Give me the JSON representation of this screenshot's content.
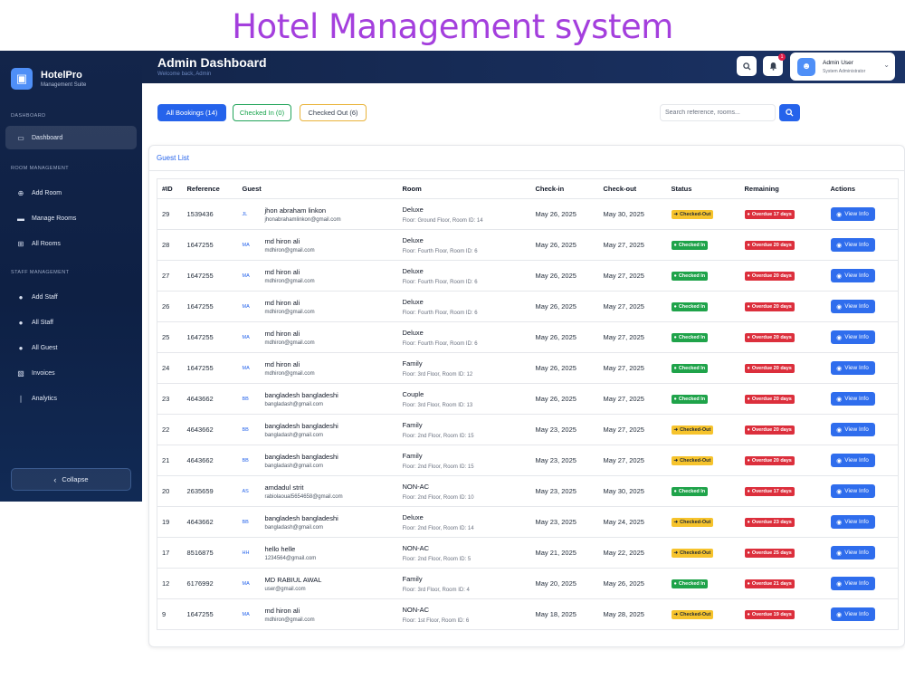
{
  "banner": {
    "title": "Hotel Management system"
  },
  "brand": {
    "name": "HotelPro",
    "subtitle": "Management Suite"
  },
  "sidebar": {
    "sections": [
      {
        "label": "DASHBOARD",
        "items": [
          {
            "label": "Dashboard",
            "icon": "monitor-icon",
            "active": true
          }
        ]
      },
      {
        "label": "ROOM MANAGEMENT",
        "items": [
          {
            "label": "Add Room",
            "icon": "plus-circle-icon"
          },
          {
            "label": "Manage Rooms",
            "icon": "bed-icon"
          },
          {
            "label": "All Rooms",
            "icon": "grid-icon"
          }
        ]
      },
      {
        "label": "STAFF MANAGEMENT",
        "items": [
          {
            "label": "Add Staff",
            "icon": "users-icon"
          },
          {
            "label": "All Staff",
            "icon": "users-icon"
          },
          {
            "label": "All Guest",
            "icon": "users-icon"
          },
          {
            "label": "Invoices",
            "icon": "file-icon"
          },
          {
            "label": "Analytics",
            "icon": "chart-icon"
          }
        ]
      }
    ],
    "collapse_label": "Collapse"
  },
  "header": {
    "title": "Admin Dashboard",
    "subtitle": "Welcome back, Admin",
    "notification_count": "1",
    "user": {
      "name": "Admin User",
      "role": "System Administrator"
    }
  },
  "filters": {
    "all": "All Bookings (14)",
    "checked_in": "Checked In (0)",
    "checked_out": "Checked Out (6)"
  },
  "search": {
    "placeholder": "Search reference, rooms..."
  },
  "tab": {
    "label": "Guest List"
  },
  "table": {
    "headers": [
      "#ID",
      "Reference",
      "Guest",
      "Room",
      "Check-in",
      "Check-out",
      "Status",
      "Remaining",
      "Actions"
    ],
    "view_label": "View Info",
    "rows": [
      {
        "id": "29",
        "ref": "1539436",
        "initials": "JL",
        "name": "jhon abraham linkon",
        "email": "jhonabrahamlinkon@gmail.com",
        "room": "Deluxe",
        "floor": "Floor: Ground Floor, Room ID: 14",
        "checkin": "May 26, 2025",
        "checkout": "May 30, 2025",
        "status": "Checked-Out",
        "status_type": "out",
        "remaining": "Overdue 17 days"
      },
      {
        "id": "28",
        "ref": "1647255",
        "initials": "MA",
        "name": "md hiron ali",
        "email": "mdhiron@gmail.com",
        "room": "Deluxe",
        "floor": "Floor: Fourth Floor, Room ID: 6",
        "checkin": "May 26, 2025",
        "checkout": "May 27, 2025",
        "status": "Checked In",
        "status_type": "in",
        "remaining": "Overdue 20 days"
      },
      {
        "id": "27",
        "ref": "1647255",
        "initials": "MA",
        "name": "md hiron ali",
        "email": "mdhiron@gmail.com",
        "room": "Deluxe",
        "floor": "Floor: Fourth Floor, Room ID: 6",
        "checkin": "May 26, 2025",
        "checkout": "May 27, 2025",
        "status": "Checked In",
        "status_type": "in",
        "remaining": "Overdue 20 days"
      },
      {
        "id": "26",
        "ref": "1647255",
        "initials": "MA",
        "name": "md hiron ali",
        "email": "mdhiron@gmail.com",
        "room": "Deluxe",
        "floor": "Floor: Fourth Floor, Room ID: 6",
        "checkin": "May 26, 2025",
        "checkout": "May 27, 2025",
        "status": "Checked In",
        "status_type": "in",
        "remaining": "Overdue 20 days"
      },
      {
        "id": "25",
        "ref": "1647255",
        "initials": "MA",
        "name": "md hiron ali",
        "email": "mdhiron@gmail.com",
        "room": "Deluxe",
        "floor": "Floor: Fourth Floor, Room ID: 6",
        "checkin": "May 26, 2025",
        "checkout": "May 27, 2025",
        "status": "Checked In",
        "status_type": "in",
        "remaining": "Overdue 20 days"
      },
      {
        "id": "24",
        "ref": "1647255",
        "initials": "MA",
        "name": "md hiron ali",
        "email": "mdhiron@gmail.com",
        "room": "Family",
        "floor": "Floor: 3rd Floor, Room ID: 12",
        "checkin": "May 26, 2025",
        "checkout": "May 27, 2025",
        "status": "Checked In",
        "status_type": "in",
        "remaining": "Overdue 20 days"
      },
      {
        "id": "23",
        "ref": "4643662",
        "initials": "BB",
        "name": "bangladesh bangladeshi",
        "email": "bangladash@gmail.com",
        "room": "Couple",
        "floor": "Floor: 3rd Floor, Room ID: 13",
        "checkin": "May 26, 2025",
        "checkout": "May 27, 2025",
        "status": "Checked In",
        "status_type": "in",
        "remaining": "Overdue 20 days"
      },
      {
        "id": "22",
        "ref": "4643662",
        "initials": "BB",
        "name": "bangladesh bangladeshi",
        "email": "bangladash@gmail.com",
        "room": "Family",
        "floor": "Floor: 2nd Floor, Room ID: 15",
        "checkin": "May 23, 2025",
        "checkout": "May 27, 2025",
        "status": "Checked-Out",
        "status_type": "out",
        "remaining": "Overdue 20 days"
      },
      {
        "id": "21",
        "ref": "4643662",
        "initials": "BB",
        "name": "bangladesh bangladeshi",
        "email": "bangladash@gmail.com",
        "room": "Family",
        "floor": "Floor: 2nd Floor, Room ID: 15",
        "checkin": "May 23, 2025",
        "checkout": "May 27, 2025",
        "status": "Checked-Out",
        "status_type": "out",
        "remaining": "Overdue 20 days"
      },
      {
        "id": "20",
        "ref": "2635659",
        "initials": "AS",
        "name": "amdadul strit",
        "email": "rabiolaoual5654658@gmail.com",
        "room": "NON-AC",
        "floor": "Floor: 2nd Floor, Room ID: 10",
        "checkin": "May 23, 2025",
        "checkout": "May 30, 2025",
        "status": "Checked In",
        "status_type": "in",
        "remaining": "Overdue 17 days"
      },
      {
        "id": "19",
        "ref": "4643662",
        "initials": "BB",
        "name": "bangladesh bangladeshi",
        "email": "bangladash@gmail.com",
        "room": "Deluxe",
        "floor": "Floor: 2nd Floor, Room ID: 14",
        "checkin": "May 23, 2025",
        "checkout": "May 24, 2025",
        "status": "Checked-Out",
        "status_type": "out",
        "remaining": "Overdue 23 days"
      },
      {
        "id": "17",
        "ref": "8516875",
        "initials": "HH",
        "name": "hello helle",
        "email": "1234564@gmail.com",
        "room": "NON-AC",
        "floor": "Floor: 2nd Floor, Room ID: 5",
        "checkin": "May 21, 2025",
        "checkout": "May 22, 2025",
        "status": "Checked-Out",
        "status_type": "out",
        "remaining": "Overdue 25 days"
      },
      {
        "id": "12",
        "ref": "6176992",
        "initials": "MA",
        "name": "MD RABIUL AWAL",
        "email": "user@gmail.com",
        "room": "Family",
        "floor": "Floor: 3rd Floor, Room ID: 4",
        "checkin": "May 20, 2025",
        "checkout": "May 26, 2025",
        "status": "Checked In",
        "status_type": "in",
        "remaining": "Overdue 21 days"
      },
      {
        "id": "9",
        "ref": "1647255",
        "initials": "MA",
        "name": "md hiron ali",
        "email": "mdhiron@gmail.com",
        "room": "NON-AC",
        "floor": "Floor: 1st Floor, Room ID: 6",
        "checkin": "May 18, 2025",
        "checkout": "May 28, 2025",
        "status": "Checked-Out",
        "status_type": "out",
        "remaining": "Overdue 19 days"
      }
    ]
  }
}
